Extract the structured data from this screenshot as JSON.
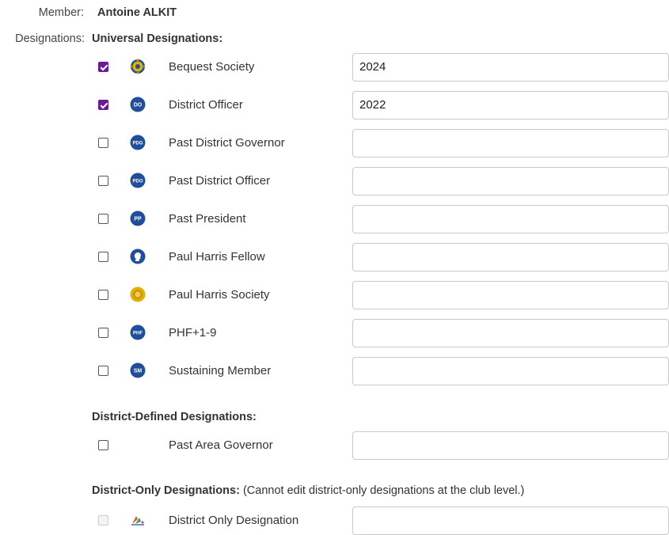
{
  "member": {
    "label": "Member:",
    "name": "Antoine ALKIT"
  },
  "designations_label": "Designations:",
  "universal": {
    "heading": "Universal Designations:",
    "items": [
      {
        "name": "Bequest Society",
        "checked": true,
        "value": "2024",
        "icon": "bequest-society-icon"
      },
      {
        "name": "District Officer",
        "checked": true,
        "value": "2022",
        "icon": "do-badge-icon",
        "badge": "DO"
      },
      {
        "name": "Past District Governor",
        "checked": false,
        "value": "",
        "icon": "pdg-badge-icon",
        "badge": "PDG"
      },
      {
        "name": "Past District Officer",
        "checked": false,
        "value": "",
        "icon": "pdo-badge-icon",
        "badge": "PDO"
      },
      {
        "name": "Past President",
        "checked": false,
        "value": "",
        "icon": "pp-badge-icon",
        "badge": "PP"
      },
      {
        "name": "Paul Harris Fellow",
        "checked": false,
        "value": "",
        "icon": "paul-harris-profile-icon"
      },
      {
        "name": "Paul Harris Society",
        "checked": false,
        "value": "",
        "icon": "paul-harris-society-icon"
      },
      {
        "name": "PHF+1-9",
        "checked": false,
        "value": "",
        "icon": "phf-badge-icon",
        "badge": "PHF"
      },
      {
        "name": "Sustaining Member",
        "checked": false,
        "value": "",
        "icon": "sm-badge-icon",
        "badge": "SM"
      }
    ]
  },
  "district_defined": {
    "heading": "District-Defined Designations:",
    "items": [
      {
        "name": "Past Area Governor",
        "checked": false,
        "value": ""
      }
    ]
  },
  "district_only": {
    "heading": "District-Only Designations:",
    "note": "(Cannot edit district-only designations at the club level.)",
    "items": [
      {
        "name": "District Only Designation",
        "checked": false,
        "value": "",
        "icon": "district-only-logo-icon",
        "disabled": true
      }
    ]
  },
  "colors": {
    "checkbox_checked": "#6a1b9a",
    "badge_blue": "#1f4e9c",
    "gold": "#e2b100"
  }
}
